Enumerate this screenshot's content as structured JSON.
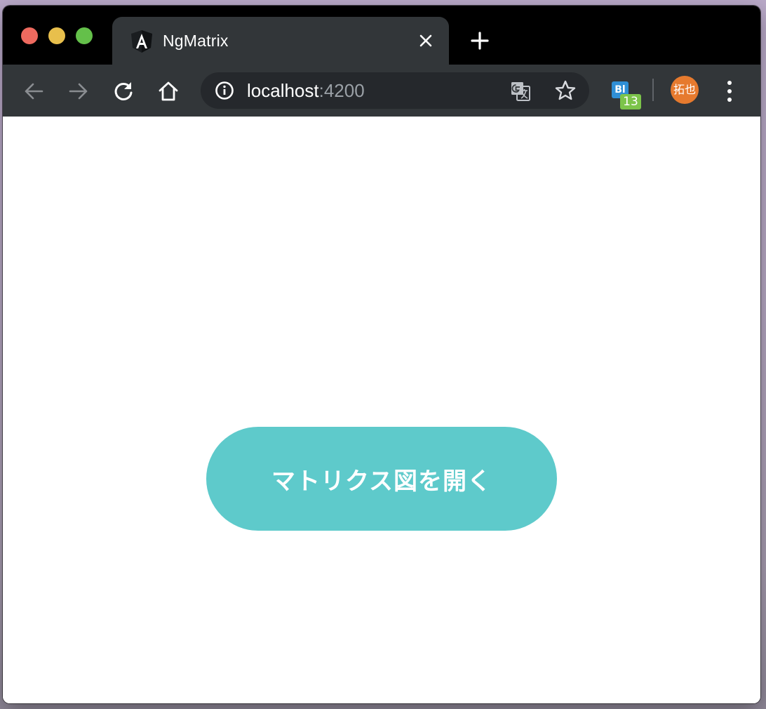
{
  "browser": {
    "tab": {
      "title": "NgMatrix",
      "favicon": "angular-logo-icon"
    },
    "omnibox": {
      "host": "localhost",
      "port": ":4200"
    },
    "extension": {
      "label": "Bl",
      "badge": "13"
    },
    "profile": {
      "name": "拓也",
      "color": "#e67a2e"
    }
  },
  "page": {
    "open_button_label": "マトリクス図を開く",
    "button_color": "#5ecacb"
  }
}
